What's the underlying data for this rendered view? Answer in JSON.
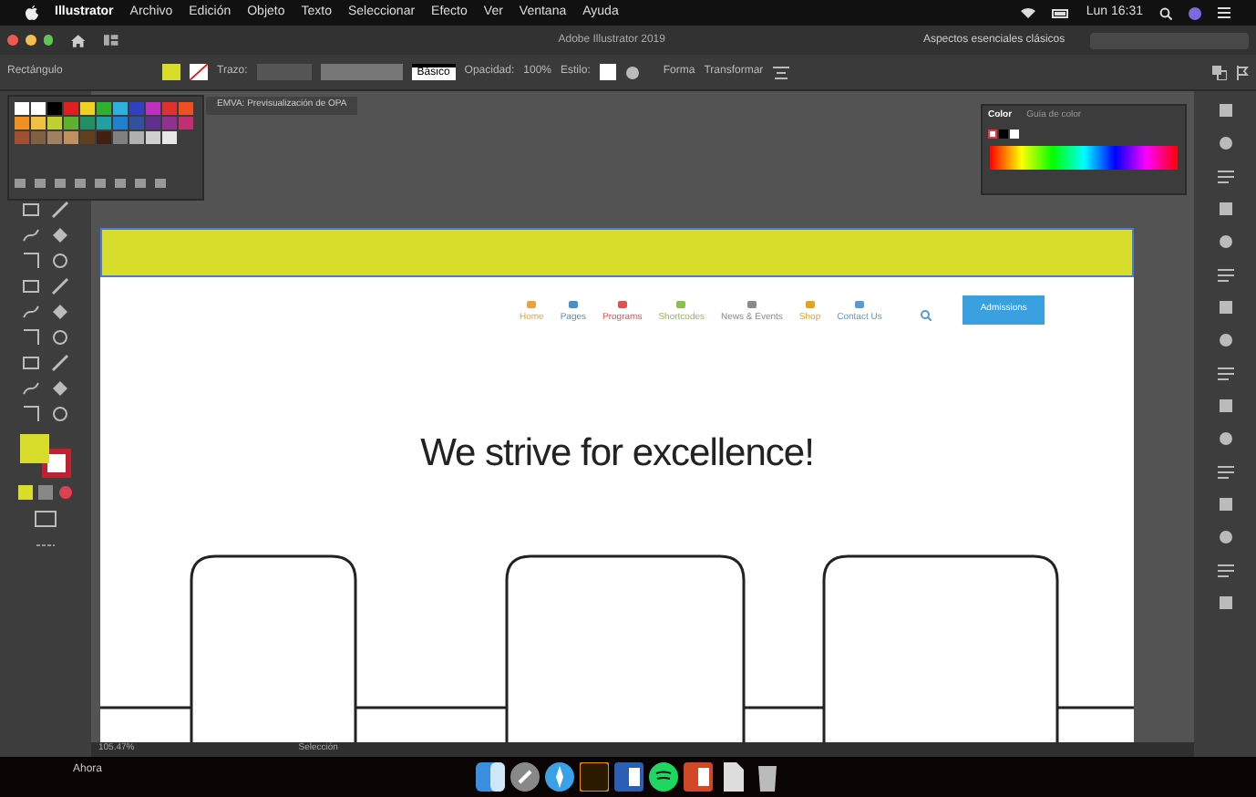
{
  "menu_bar": {
    "items": [
      "Illustrator",
      "Archivo",
      "Edición",
      "Objeto",
      "Texto",
      "Seleccionar",
      "Efecto",
      "Ver",
      "Ventana",
      "Ayuda"
    ],
    "clock": "Lun 16:31"
  },
  "title_bar": {
    "title": "Adobe Illustrator 2019",
    "workspace": "Aspectos esenciales clásicos"
  },
  "control_bar": {
    "tool": "Rectángulo",
    "stroke_label": "Trazo:",
    "stroke_style": "Básico",
    "opacity_label": "Opacidad:",
    "opacity": "100%",
    "style_label": "Estilo:",
    "shape": "Forma",
    "transform": "Transformar"
  },
  "document_tab": "EMVA: Previsualización de OPA",
  "color_panel": {
    "tabs": [
      {
        "label": "Color",
        "selected": true
      },
      {
        "label": "Guía de color",
        "selected": false
      }
    ]
  },
  "artboard": {
    "nav": [
      {
        "label": "Home",
        "color": "#e8a33a"
      },
      {
        "label": "Pages",
        "color": "#4a90c8"
      },
      {
        "label": "Programs",
        "color": "#e05050"
      },
      {
        "label": "Shortcodes",
        "color": "#8cbf4a"
      },
      {
        "label": "News & Events",
        "color": "#8a8a8a"
      },
      {
        "label": "Shop",
        "color": "#e8a020"
      },
      {
        "label": "Contact Us",
        "color": "#5a9ad0"
      }
    ],
    "button": "Admissions",
    "heading": "We strive for excellence!"
  },
  "status_bar": {
    "zoom": "105.47%",
    "tool": "Selección"
  },
  "dock": {
    "label": "Ahora"
  }
}
